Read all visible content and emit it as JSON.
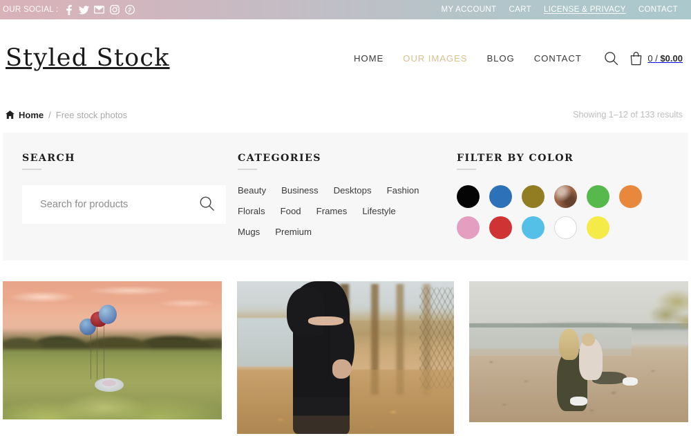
{
  "topbar": {
    "social_label": "OUR SOCIAL :",
    "social_icons": [
      {
        "name": "facebook-icon",
        "title": "Facebook"
      },
      {
        "name": "twitter-icon",
        "title": "Twitter"
      },
      {
        "name": "email-icon",
        "title": "Email"
      },
      {
        "name": "instagram-icon",
        "title": "Instagram"
      },
      {
        "name": "pinterest-icon",
        "title": "Pinterest"
      }
    ],
    "links": [
      {
        "label": "MY ACCOUNT"
      },
      {
        "label": "CART"
      },
      {
        "label": "LICENSE & PRIVACY"
      },
      {
        "label": "CONTACT"
      }
    ],
    "gradient_start": "#d9b2b8",
    "gradient_end": "#abc8cc"
  },
  "header": {
    "logo": "Styled Stock",
    "nav": [
      {
        "label": "HOME",
        "active": false
      },
      {
        "label": "OUR IMAGES",
        "active": true
      },
      {
        "label": "BLOG",
        "active": false
      },
      {
        "label": "CONTACT",
        "active": false
      }
    ],
    "active_nav_color": "#d6c190",
    "search_icon": "search-icon",
    "cart_icon": "shopping-bag-icon",
    "cart_count": "0",
    "cart_separator": "/",
    "cart_total": "$0.00"
  },
  "breadcrumb": {
    "home_icon": "home-icon",
    "home_label": "Home",
    "separator": "/",
    "current": "Free stock photos",
    "results_text": "Showing 1–12 of 133 results"
  },
  "filters": {
    "search": {
      "heading": "SEARCH",
      "placeholder": "Search for products",
      "value": "",
      "button_icon": "search-icon"
    },
    "categories": {
      "heading": "CATEGORIES",
      "items": [
        {
          "label": "Beauty"
        },
        {
          "label": "Business"
        },
        {
          "label": "Desktops"
        },
        {
          "label": "Fashion"
        },
        {
          "label": "Florals"
        },
        {
          "label": "Food"
        },
        {
          "label": "Frames"
        },
        {
          "label": "Lifestyle"
        },
        {
          "label": "Mugs"
        },
        {
          "label": "Premium"
        }
      ]
    },
    "color": {
      "heading": "FILTER BY COLOR",
      "swatches": [
        {
          "name": "black",
          "hex": "#050505"
        },
        {
          "name": "blue",
          "hex": "#2d72b8"
        },
        {
          "name": "gold",
          "hex": "#937d22"
        },
        {
          "name": "brown",
          "hex": "#9c6445"
        },
        {
          "name": "green",
          "hex": "#57b94b"
        },
        {
          "name": "orange",
          "hex": "#e8883c"
        },
        {
          "name": "pink",
          "hex": "#e39ec0"
        },
        {
          "name": "red",
          "hex": "#cf3333"
        },
        {
          "name": "light-blue",
          "hex": "#54c0e8"
        },
        {
          "name": "white",
          "hex": "#ffffff"
        },
        {
          "name": "yellow",
          "hex": "#f4ea48"
        }
      ]
    },
    "panel_bg": "#f7f7f7"
  },
  "products": [
    {
      "name": "baby-with-balloons-in-field",
      "alt": "Baby in a blanket nest in a sunlit grassy field with heart balloons at sunset"
    },
    {
      "name": "pregnant-woman-autumn-park",
      "alt": "Pregnant woman in a black dress holding her bump in an autumn tree-lined park"
    },
    {
      "name": "mother-and-child-on-beach",
      "alt": "Mother kissing toddler while sitting on a sandy lakeshore at golden hour"
    }
  ]
}
